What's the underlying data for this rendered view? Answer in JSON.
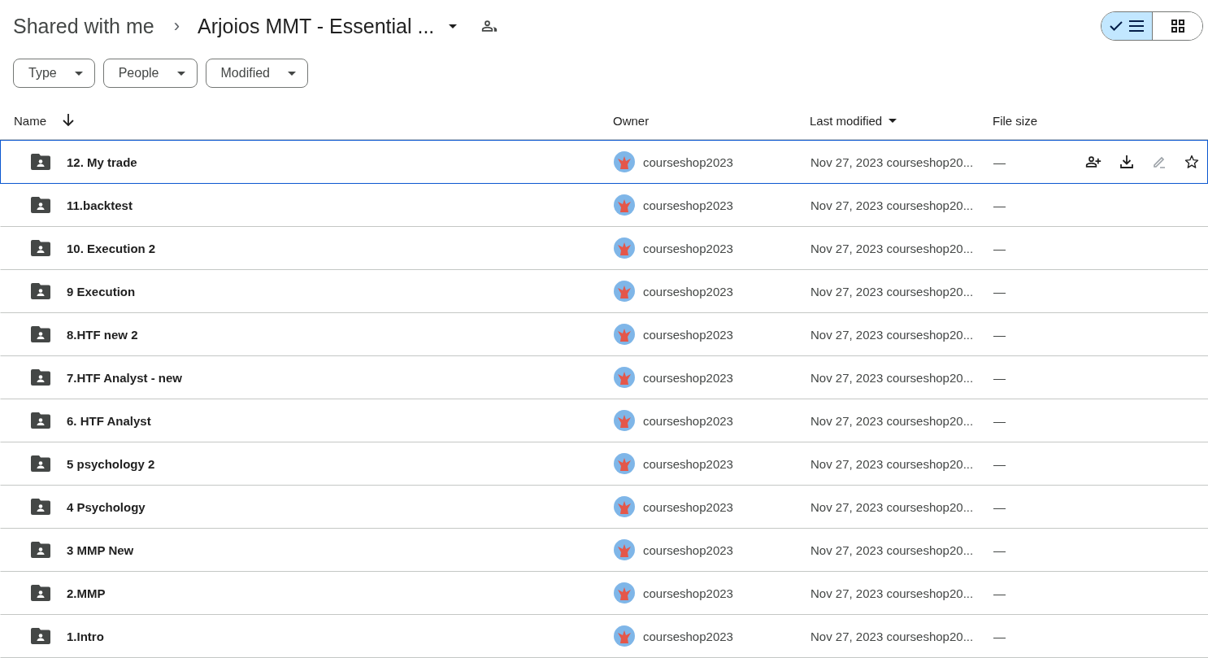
{
  "breadcrumb": {
    "parent": "Shared with me",
    "separator": "›",
    "current": "Arjoios MMT - Essential ..."
  },
  "view_toggle": [
    {
      "kind": "list",
      "selected": true
    },
    {
      "kind": "grid",
      "selected": false
    }
  ],
  "filters": [
    {
      "label": "Type"
    },
    {
      "label": "People"
    },
    {
      "label": "Modified"
    }
  ],
  "table": {
    "columns": [
      {
        "label": "Name",
        "kind": "sorted"
      },
      {
        "label": "Owner",
        "kind": "plain"
      },
      {
        "label": "Last modified",
        "kind": "dropdown"
      },
      {
        "label": "File size",
        "kind": "plain"
      }
    ],
    "rows": [
      {
        "name": "12. My trade",
        "owner": "courseshop2023",
        "modified": "Nov 27, 2023 courseshop20...",
        "size": "—",
        "focused": true
      },
      {
        "name": "11.backtest",
        "owner": "courseshop2023",
        "modified": "Nov 27, 2023 courseshop20...",
        "size": "—",
        "focused": false
      },
      {
        "name": "10. Execution 2",
        "owner": "courseshop2023",
        "modified": "Nov 27, 2023 courseshop20...",
        "size": "—",
        "focused": false
      },
      {
        "name": "9 Execution",
        "owner": "courseshop2023",
        "modified": "Nov 27, 2023 courseshop20...",
        "size": "—",
        "focused": false
      },
      {
        "name": "8.HTF new 2",
        "owner": "courseshop2023",
        "modified": "Nov 27, 2023 courseshop20...",
        "size": "—",
        "focused": false
      },
      {
        "name": "7.HTF Analyst - new",
        "owner": "courseshop2023",
        "modified": "Nov 27, 2023 courseshop20...",
        "size": "—",
        "focused": false
      },
      {
        "name": "6. HTF Analyst",
        "owner": "courseshop2023",
        "modified": "Nov 27, 2023 courseshop20...",
        "size": "—",
        "focused": false
      },
      {
        "name": "5 psychology 2",
        "owner": "courseshop2023",
        "modified": "Nov 27, 2023 courseshop20...",
        "size": "—",
        "focused": false
      },
      {
        "name": "4 Psychology",
        "owner": "courseshop2023",
        "modified": "Nov 27, 2023 courseshop20...",
        "size": "—",
        "focused": false
      },
      {
        "name": "3 MMP New",
        "owner": "courseshop2023",
        "modified": "Nov 27, 2023 courseshop20...",
        "size": "—",
        "focused": false
      },
      {
        "name": "2.MMP",
        "owner": "courseshop2023",
        "modified": "Nov 27, 2023 courseshop20...",
        "size": "—",
        "focused": false
      },
      {
        "name": "1.Intro",
        "owner": "courseshop2023",
        "modified": "Nov 27, 2023 courseshop20...",
        "size": "—",
        "focused": false
      }
    ]
  }
}
